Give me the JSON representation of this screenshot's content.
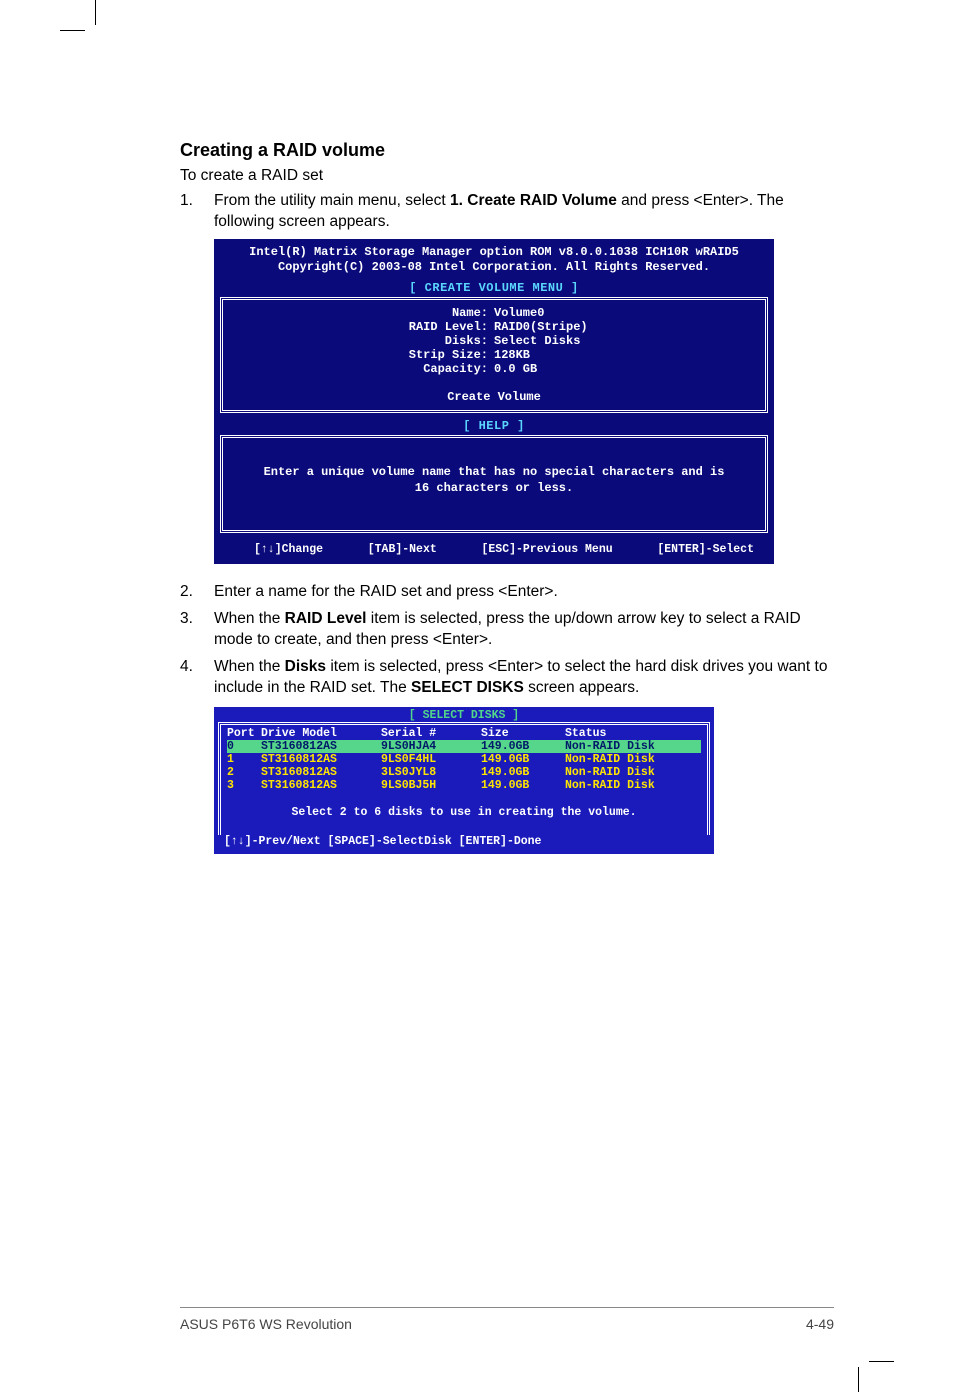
{
  "section_title": "Creating a RAID volume",
  "intro": "To create a RAID set",
  "step1": {
    "num": "1.",
    "text_a": "From the utility main menu, select ",
    "bold": "1. Create RAID Volume",
    "text_b": " and press <Enter>. The following screen appears."
  },
  "bios": {
    "header1": "Intel(R) Matrix Storage Manager option ROM v8.0.0.1038 ICH10R wRAID5",
    "header2": "Copyright(C) 2003-08 Intel Corporation.  All Rights Reserved.",
    "create_title": "[ CREATE VOLUME MENU ]",
    "rows": [
      {
        "k": "Name:",
        "v": "Volume0",
        "sel": true
      },
      {
        "k": "RAID Level:",
        "v": "RAID0(Stripe)"
      },
      {
        "k": "Disks:",
        "v": "Select Disks"
      },
      {
        "k": "Strip Size:",
        "v": "128KB"
      },
      {
        "k": "Capacity:",
        "v": "0.0   GB"
      }
    ],
    "create_volume": "Create Volume",
    "help_title": "[ HELP ]",
    "help1": "Enter a unique volume name that has no special characters and is",
    "help2": "16 characters or less.",
    "footer": {
      "f1": "[↑↓]Change",
      "f2": "[TAB]-Next",
      "f3": "[ESC]-Previous Menu",
      "f4": "[ENTER]-Select"
    }
  },
  "step2": {
    "num": "2.",
    "text": "Enter a name for the RAID set and press <Enter>."
  },
  "step3": {
    "num": "3.",
    "a": "When the ",
    "b": "RAID Level",
    "c": " item is selected, press the up/down arrow key to select a RAID mode to create, and then press <Enter>."
  },
  "step4": {
    "num": "4.",
    "a": "When the ",
    "b": "Disks",
    "c": " item is selected, press <Enter> to select the hard disk drives you want to include in the RAID set. The ",
    "d": "SELECT DISKS",
    "e": " screen appears."
  },
  "select_disks": {
    "title": "[ SELECT DISKS ]",
    "hdr": {
      "c1": "Port",
      "c2": "Drive Model",
      "c3": "Serial #",
      "c4": "Size",
      "c5": "Status"
    },
    "rows": [
      {
        "c1": "0",
        "c2": "ST3160812AS",
        "c3": "9LS0HJA4",
        "c4": "149.0GB",
        "c5": "Non-RAID Disk",
        "sel": true
      },
      {
        "c1": "1",
        "c2": "ST3160812AS",
        "c3": "9LS0F4HL",
        "c4": "149.0GB",
        "c5": "Non-RAID Disk"
      },
      {
        "c1": "2",
        "c2": "ST3160812AS",
        "c3": "3LS0JYL8",
        "c4": "149.0GB",
        "c5": "Non-RAID Disk"
      },
      {
        "c1": "3",
        "c2": "ST3160812AS",
        "c3": "9LS0BJ5H",
        "c4": "149.0GB",
        "c5": "Non-RAID Disk"
      }
    ],
    "msg": "Select 2 to 6 disks to use in creating the volume.",
    "footer": "[↑↓]-Prev/Next [SPACE]-SelectDisk [ENTER]-Done"
  },
  "page_footer": {
    "left": "ASUS P6T6 WS Revolution",
    "right": "4-49"
  },
  "chart_data": {
    "type": "table",
    "title": "SELECT DISKS",
    "columns": [
      "Port",
      "Drive Model",
      "Serial #",
      "Size",
      "Status"
    ],
    "rows": [
      [
        "0",
        "ST3160812AS",
        "9LS0HJA4",
        "149.0GB",
        "Non-RAID Disk"
      ],
      [
        "1",
        "ST3160812AS",
        "9LS0F4HL",
        "149.0GB",
        "Non-RAID Disk"
      ],
      [
        "2",
        "ST3160812AS",
        "3LS0JYL8",
        "149.0GB",
        "Non-RAID Disk"
      ],
      [
        "3",
        "ST3160812AS",
        "9LS0BJ5H",
        "149.0GB",
        "Non-RAID Disk"
      ]
    ]
  }
}
